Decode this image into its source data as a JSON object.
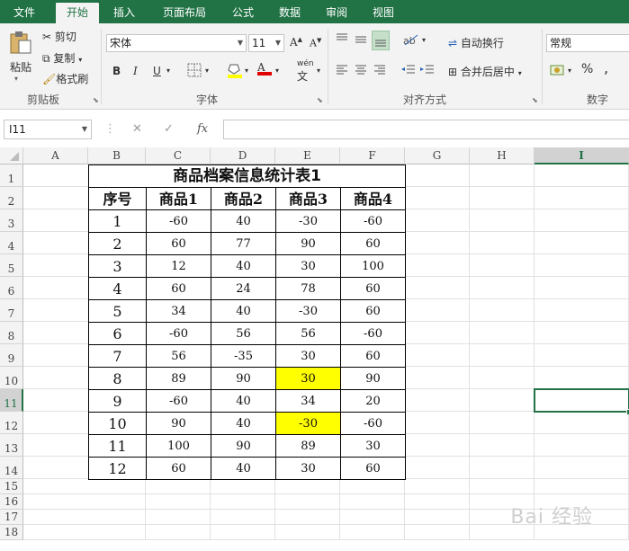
{
  "tabs": [
    "文件",
    "开始",
    "插入",
    "页面布局",
    "公式",
    "数据",
    "审阅",
    "视图"
  ],
  "ribbon": {
    "clipboard": {
      "paste": "粘贴",
      "cut": "剪切",
      "copy": "复制",
      "format_painter": "格式刷",
      "label": "剪贴板"
    },
    "font": {
      "name": "宋体",
      "size": "11",
      "bold": "B",
      "italic": "I",
      "underline": "U",
      "font_color": "A",
      "phonetic": "wén",
      "label": "字体"
    },
    "alignment": {
      "wrap": "自动换行",
      "merge": "合并后居中",
      "label": "对齐方式"
    },
    "number": {
      "format": "常规",
      "percent": "%",
      "comma": ",",
      "label": "数字"
    }
  },
  "formula_bar": {
    "name_box": "I11",
    "fx": "fx",
    "value": ""
  },
  "columns": [
    "A",
    "B",
    "C",
    "D",
    "E",
    "F",
    "G",
    "H",
    "I"
  ],
  "selected_column": "I",
  "rows": [
    "1",
    "2",
    "3",
    "4",
    "5",
    "6",
    "7",
    "8",
    "9",
    "10",
    "11",
    "12",
    "13",
    "14",
    "15",
    "16",
    "17",
    "18"
  ],
  "selected_row": "11",
  "table": {
    "title": "商品档案信息统计表1",
    "headers": [
      "序号",
      "商品1",
      "商品2",
      "商品3",
      "商品4"
    ],
    "rows": [
      [
        "1",
        "-60",
        "40",
        "-30",
        "-60"
      ],
      [
        "2",
        "60",
        "77",
        "90",
        "60"
      ],
      [
        "3",
        "12",
        "40",
        "30",
        "100"
      ],
      [
        "4",
        "60",
        "24",
        "78",
        "60"
      ],
      [
        "5",
        "34",
        "40",
        "-30",
        "60"
      ],
      [
        "6",
        "-60",
        "56",
        "56",
        "-60"
      ],
      [
        "7",
        "56",
        "-35",
        "30",
        "60"
      ],
      [
        "8",
        "89",
        "90",
        "30",
        "90"
      ],
      [
        "9",
        "-60",
        "40",
        "34",
        "20"
      ],
      [
        "10",
        "90",
        "40",
        "-30",
        "-60"
      ],
      [
        "11",
        "100",
        "90",
        "89",
        "30"
      ],
      [
        "12",
        "60",
        "40",
        "30",
        "60"
      ]
    ],
    "highlighted": [
      [
        7,
        3
      ],
      [
        9,
        3
      ]
    ],
    "highlight_color": "#ffff00"
  },
  "accent_color": "#217346",
  "watermark": "Bai 经验"
}
